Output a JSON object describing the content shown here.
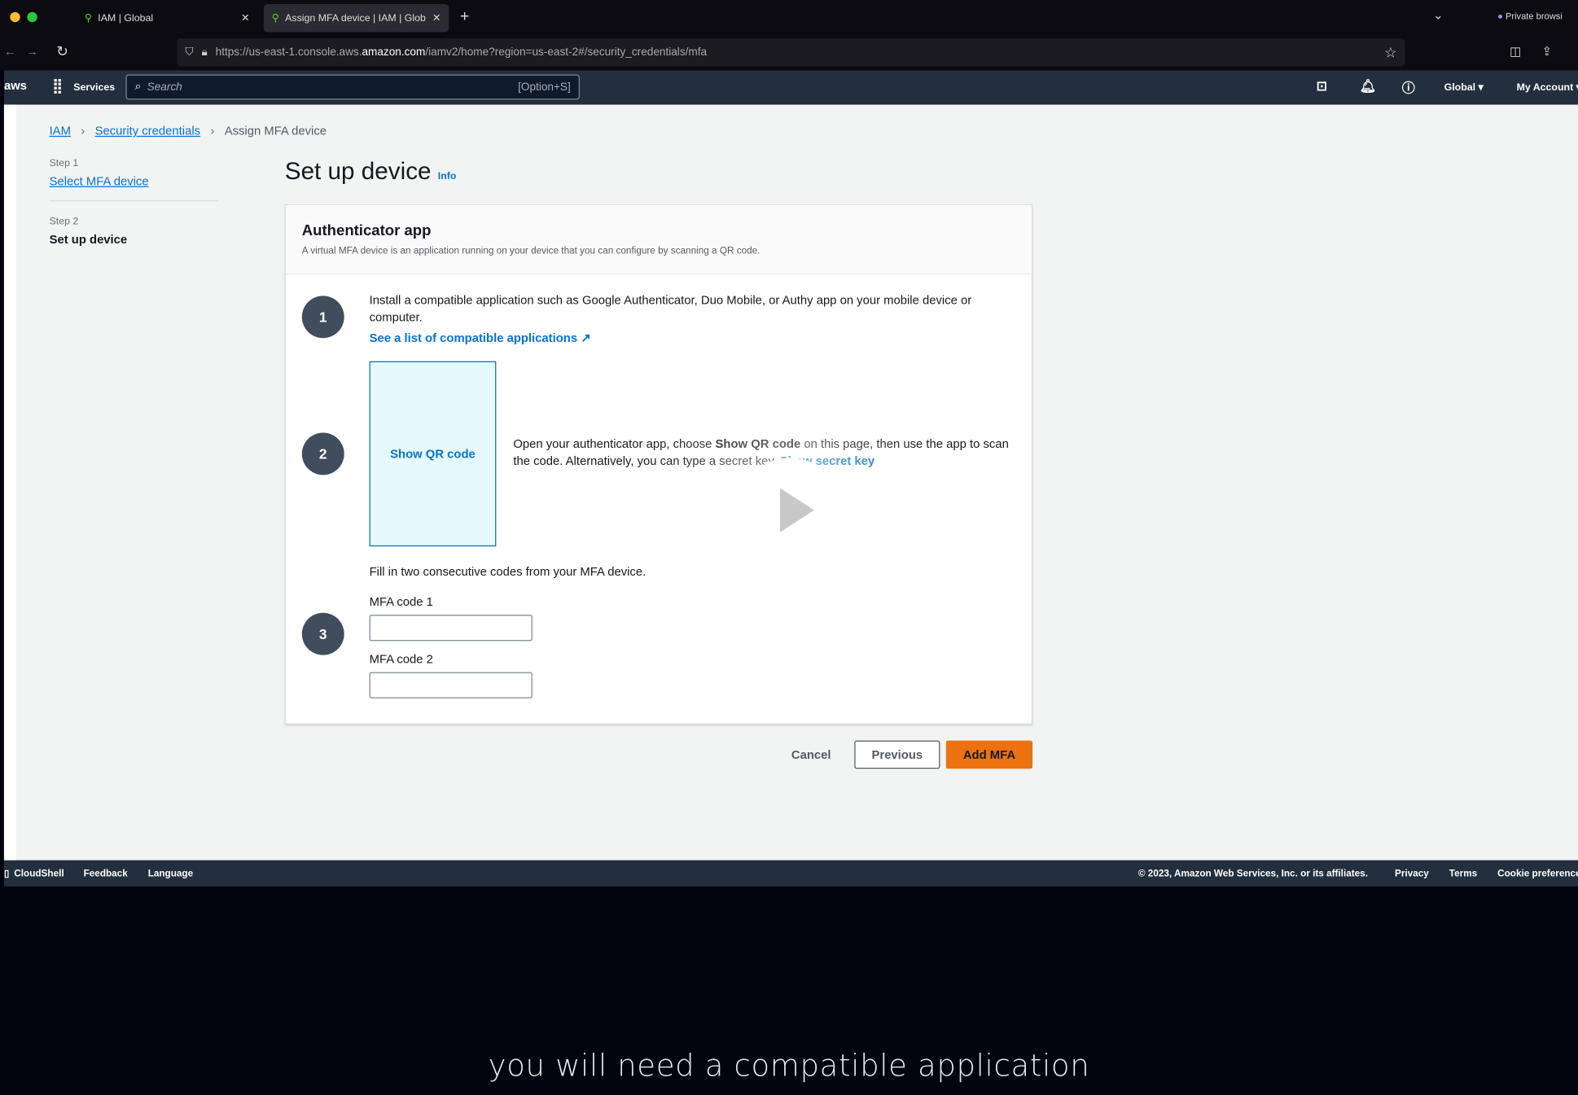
{
  "browser": {
    "tabs": [
      {
        "label": "IAM | Global"
      },
      {
        "label": "Assign MFA device | IAM | Glob"
      }
    ],
    "private_label": "Private browsi",
    "url_prefix": "https://us-east-1.console.aws.",
    "url_domain": "amazon.com",
    "url_suffix": "/iamv2/home?region=us-east-2#/security_credentials/mfa"
  },
  "aws_nav": {
    "logo": "aws",
    "services": "Services",
    "search_placeholder": "Search",
    "search_shortcut": "[Option+S]",
    "region": "Global ▾",
    "account": "My Account ▾"
  },
  "breadcrumb": [
    "IAM",
    "Security credentials",
    "Assign MFA device"
  ],
  "steps": [
    {
      "step": "Step 1",
      "label": "Select MFA device"
    },
    {
      "step": "Step 2",
      "label": "Set up device"
    }
  ],
  "page": {
    "title": "Set up device",
    "info": "Info",
    "card_title": "Authenticator app",
    "card_desc": "A virtual MFA device is an application running on your device that you can configure by scanning a QR code.",
    "step1_num": "1",
    "step1_text": "Install a compatible application such as Google Authenticator, Duo Mobile, or Authy app on your mobile device or computer.",
    "step1_link": "See a list of compatible applications",
    "step2_num": "2",
    "show_qr": "Show QR code",
    "step2_text_a": "Open your authenticator app, choose ",
    "step2_text_bold": "Show QR code",
    "step2_text_b": " on this page, then use the app to scan the code. Alternatively, you can type a secret key. ",
    "step2_link": "Show secret key",
    "step3_num": "3",
    "step3_text": "Fill in two consecutive codes from your MFA device.",
    "mfa1_label": "MFA code 1",
    "mfa1_value": "",
    "mfa2_label": "MFA code 2",
    "mfa2_value": "",
    "cancel": "Cancel",
    "previous": "Previous",
    "add": "Add MFA"
  },
  "footer": {
    "cloudshell": "CloudShell",
    "feedback": "Feedback",
    "language": "Language",
    "copyright": "© 2023, Amazon Web Services, Inc. or its affiliates.",
    "privacy": "Privacy",
    "terms": "Terms",
    "cookies": "Cookie preferences"
  },
  "caption": "you will need a compatible application",
  "colors": {
    "accent": "#ec7211",
    "link": "#0972d3",
    "nav": "#232f3e"
  }
}
